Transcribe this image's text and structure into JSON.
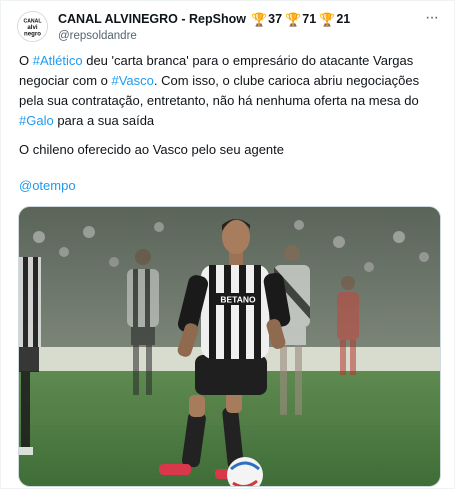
{
  "author": {
    "name": "CANAL ALVINEGRO - RepShow",
    "handle": "@repsoldandre",
    "avatar_text": [
      "CANAL",
      "alvi",
      "negro"
    ],
    "badges": [
      {
        "icon": "trophy-icon",
        "count": "37"
      },
      {
        "icon": "trophy-icon",
        "count": "71"
      },
      {
        "icon": "trophy-icon",
        "count": "21"
      }
    ]
  },
  "more_icon": "more-horizontal-icon",
  "tweet": {
    "segments": [
      {
        "text": "O ",
        "link": false
      },
      {
        "text": "#Atlético",
        "link": true
      },
      {
        "text": " deu 'carta branca' para o empresário do atacante Vargas negociar com o ",
        "link": false
      },
      {
        "text": "#Vasco",
        "link": true
      },
      {
        "text": ". Com isso, o clube carioca abriu negociações pela sua contratação, entretanto, não há nenhuma oferta na mesa do ",
        "link": false
      },
      {
        "text": "#Galo",
        "link": true
      },
      {
        "text": " para a sua saída",
        "link": false
      }
    ],
    "paragraph2": "O chileno oferecido ao Vasco pelo seu agente",
    "mention": "@otempo"
  },
  "media": {
    "shirt_sponsor": "BETANO"
  },
  "colors": {
    "link": "#1d9bf0",
    "text": "#0f1419",
    "secondary": "#536471",
    "pitch": "#4f7d45",
    "trophy": "#c9a227"
  }
}
